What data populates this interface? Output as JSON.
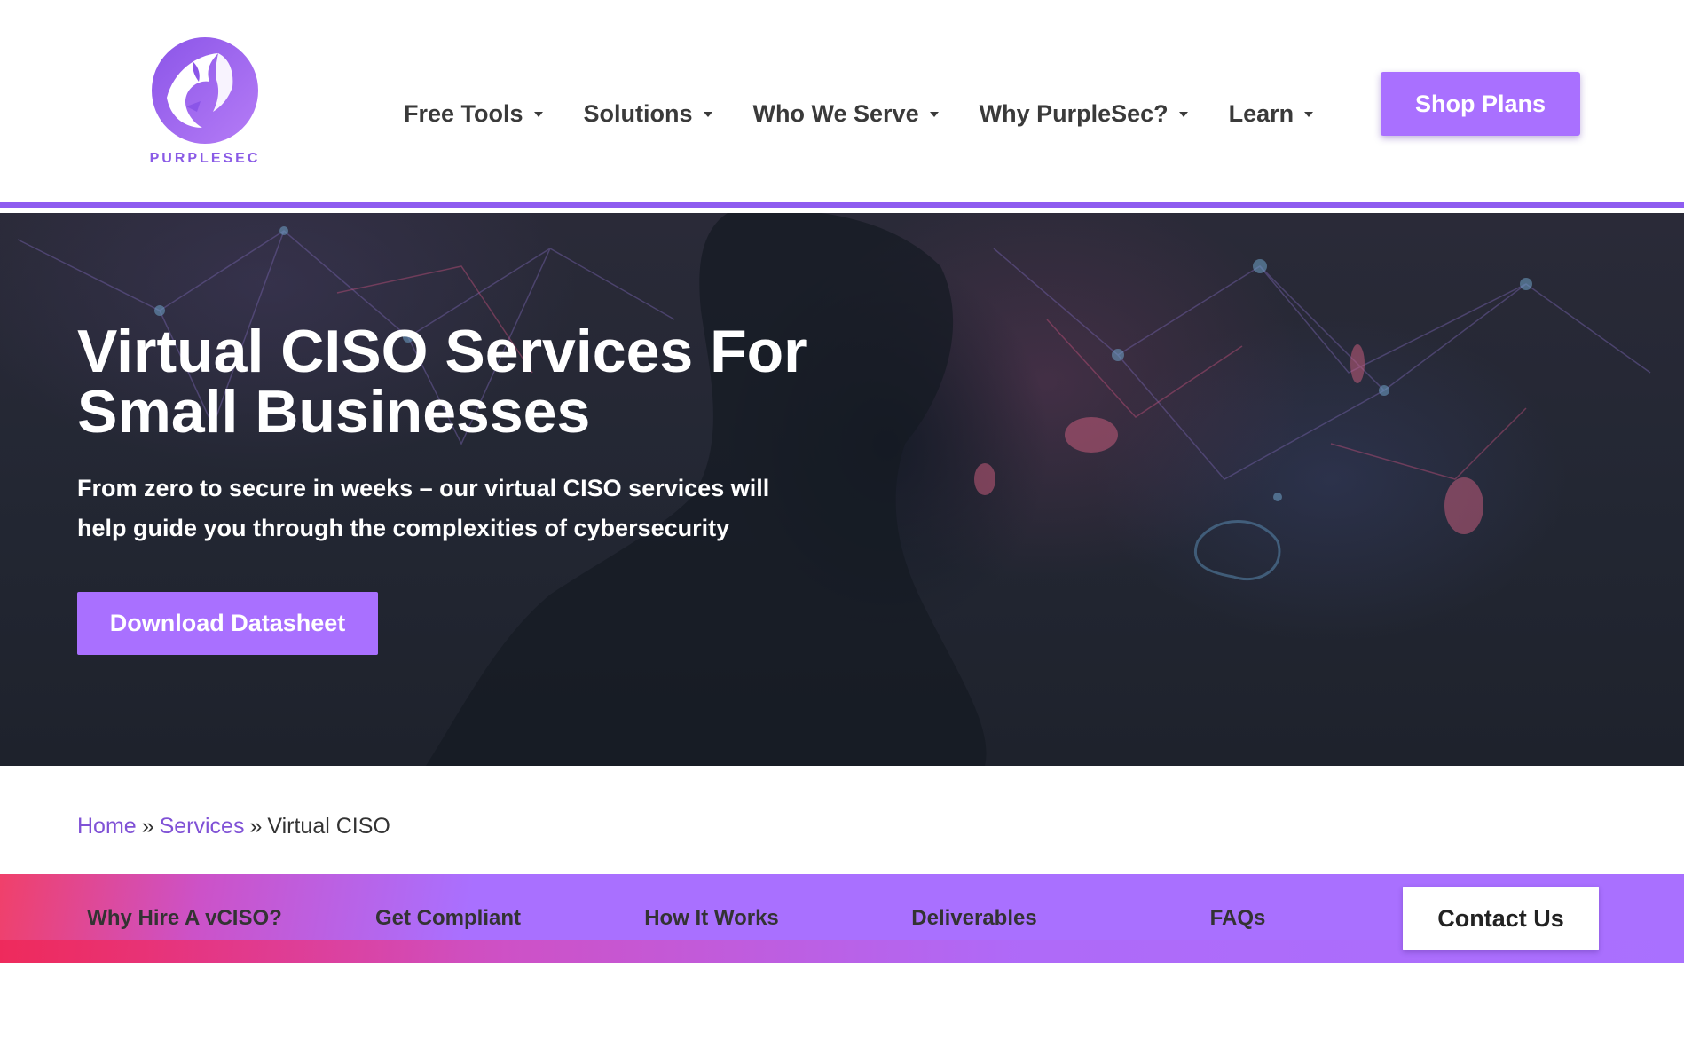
{
  "header": {
    "logo_text": "PURPLESEC",
    "nav": [
      {
        "label": "Free Tools"
      },
      {
        "label": "Solutions"
      },
      {
        "label": "Who We Serve"
      },
      {
        "label": "Why PurpleSec?"
      },
      {
        "label": "Learn"
      }
    ],
    "shop_label": "Shop Plans"
  },
  "hero": {
    "title": "Virtual CISO Services For Small Businesses",
    "subtitle": "From zero to secure in weeks – our virtual CISO services will help guide you through the complexities of cybersecurity",
    "cta_label": "Download Datasheet"
  },
  "breadcrumb": {
    "items": [
      "Home",
      "Services",
      "Virtual CISO"
    ],
    "separator": "»"
  },
  "subnav": {
    "items": [
      {
        "label": "Why Hire A vCISO?"
      },
      {
        "label": "Get Compliant"
      },
      {
        "label": "How It Works"
      },
      {
        "label": "Deliverables"
      },
      {
        "label": "FAQs"
      }
    ],
    "contact_label": "Contact Us"
  },
  "colors": {
    "accent": "#a970ff",
    "accent_dark": "#8e5cf0",
    "link": "#8052d6",
    "gradient_pink": "#f0406a"
  },
  "icons": {
    "logo": "purple-dragon-logo-icon",
    "nav_caret": "caret-down-icon"
  }
}
